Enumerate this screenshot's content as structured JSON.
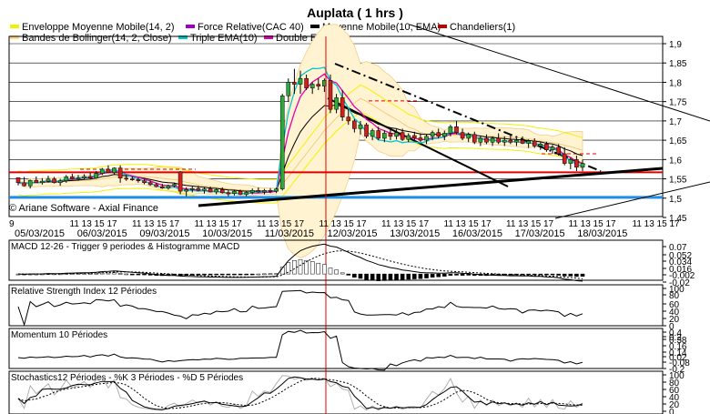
{
  "chart_title": "Auplata  ( 1 hrs )",
  "watermark": "© Ariane Software - Axial Finance",
  "legend": [
    {
      "label": "Enveloppe Moyenne Mobile(14, 2)",
      "color": "#f2f200"
    },
    {
      "label": "Force Relative(CAC 40)",
      "color": "#a000c0"
    },
    {
      "label": "Moyenne Mobile(10, EMA)",
      "color": "#000000"
    },
    {
      "label": "Chandeliers(1)",
      "color": "#c00000"
    },
    {
      "label": "Bandes de Bollinger(14, 2, Close)",
      "color": "#ffd68a"
    },
    {
      "label": "Triple EMA(10)",
      "color": "#00c8d2"
    },
    {
      "label": "Double EMA(10)",
      "color": "#e000b0"
    }
  ],
  "hour_ticks": [
    {
      "slot": 0,
      "label": "9"
    },
    {
      "slot": 1,
      "label": "11 13 15 17"
    },
    {
      "slot": 2,
      "label": "11 13 15 17"
    },
    {
      "slot": 3,
      "label": "11 13 15 17"
    },
    {
      "slot": 4,
      "label": "11 13 15 17"
    },
    {
      "slot": 5,
      "label": "11 13 15 17"
    },
    {
      "slot": 6,
      "label": "11 13 15 17"
    },
    {
      "slot": 7,
      "label": "11 13 15 17"
    },
    {
      "slot": 8,
      "label": "11 13 15 17"
    },
    {
      "slot": 9,
      "label": "11 13 15 17"
    }
  ],
  "date_labels": [
    {
      "slot": 0,
      "label": "05/03/2015"
    },
    {
      "slot": 1,
      "label": "06/03/2015"
    },
    {
      "slot": 2,
      "label": "09/03/2015"
    },
    {
      "slot": 3,
      "label": "10/03/2015"
    },
    {
      "slot": 4,
      "label": "11/03/2015"
    },
    {
      "slot": 5,
      "label": "12/03/2015"
    },
    {
      "slot": 6,
      "label": "13/03/2015"
    },
    {
      "slot": 7,
      "label": "16/03/2015"
    },
    {
      "slot": 8,
      "label": "17/03/2015"
    },
    {
      "slot": 9,
      "label": "18/03/2015"
    }
  ],
  "panels": {
    "price": {
      "ticks": [
        "1,9",
        "1,85",
        "1,8",
        "1,75",
        "1,7",
        "1,65",
        "1,6",
        "1,55",
        "1,5",
        "1,45"
      ]
    },
    "macd": {
      "label": "MACD 12-26  -  Trigger 9 periodes & Histogramme MACD",
      "ticks": [
        "0.07",
        "0.052",
        "0.034",
        "0.016",
        "-0.002",
        "-0.02"
      ]
    },
    "rsi": {
      "label": "Relative Strength Index 12 Périodes",
      "ticks": [
        "100",
        "80",
        "60",
        "40",
        "20",
        "0"
      ]
    },
    "momentum": {
      "label": "Momentum 10 Périodes",
      "ticks": [
        "0.4",
        "0.2",
        "0.38",
        "0.16",
        "0.14",
        "0.02",
        "-0.08",
        "-0.2"
      ]
    },
    "stochastics": {
      "label": "Stochastics12 Périodes  -  %K 3 Périodes  -  %D 5 Périodes",
      "ticks": [
        "100",
        "80",
        "60",
        "40",
        "20",
        "0"
      ]
    }
  },
  "chart_data": {
    "type": "candlestick",
    "title": "Auplata  ( 1 hrs )",
    "y_range": [
      1.45,
      1.92
    ],
    "candles": [
      [
        1.553,
        1.553,
        1.533,
        1.54
      ],
      [
        1.54,
        1.555,
        1.53,
        1.532
      ],
      [
        1.532,
        1.548,
        1.525,
        1.546
      ],
      [
        1.546,
        1.556,
        1.54,
        1.54
      ],
      [
        1.54,
        1.552,
        1.535,
        1.544
      ],
      [
        1.544,
        1.558,
        1.54,
        1.55
      ],
      [
        1.55,
        1.555,
        1.538,
        1.54
      ],
      [
        1.54,
        1.55,
        1.532,
        1.545
      ],
      [
        1.545,
        1.56,
        1.54,
        1.555
      ],
      [
        1.555,
        1.563,
        1.548,
        1.55
      ],
      [
        1.55,
        1.56,
        1.545,
        1.552
      ],
      [
        1.552,
        1.562,
        1.548,
        1.556
      ],
      [
        1.556,
        1.566,
        1.55,
        1.552
      ],
      [
        1.552,
        1.57,
        1.55,
        1.564
      ],
      [
        1.564,
        1.578,
        1.56,
        1.575
      ],
      [
        1.575,
        1.585,
        1.565,
        1.566
      ],
      [
        1.566,
        1.58,
        1.56,
        1.578
      ],
      [
        1.578,
        1.585,
        1.54,
        1.552
      ],
      [
        1.552,
        1.56,
        1.545,
        1.55
      ],
      [
        1.55,
        1.556,
        1.545,
        1.548
      ],
      [
        1.548,
        1.553,
        1.54,
        1.545
      ],
      [
        1.545,
        1.55,
        1.536,
        1.54
      ],
      [
        1.54,
        1.546,
        1.532,
        1.535
      ],
      [
        1.535,
        1.54,
        1.528,
        1.53
      ],
      [
        1.53,
        1.537,
        1.524,
        1.526
      ],
      [
        1.526,
        1.535,
        1.522,
        1.532
      ],
      [
        1.532,
        1.54,
        1.528,
        1.536
      ],
      [
        1.568,
        1.57,
        1.51,
        1.518
      ],
      [
        1.518,
        1.528,
        1.505,
        1.522
      ],
      [
        1.522,
        1.53,
        1.515,
        1.525
      ],
      [
        1.525,
        1.532,
        1.518,
        1.52
      ],
      [
        1.52,
        1.528,
        1.512,
        1.524
      ],
      [
        1.524,
        1.53,
        1.515,
        1.516
      ],
      [
        1.516,
        1.525,
        1.51,
        1.522
      ],
      [
        1.522,
        1.528,
        1.512,
        1.514
      ],
      [
        1.514,
        1.52,
        1.505,
        1.512
      ],
      [
        1.512,
        1.522,
        1.507,
        1.518
      ],
      [
        1.518,
        1.522,
        1.508,
        1.51
      ],
      [
        1.51,
        1.518,
        1.505,
        1.515
      ],
      [
        1.515,
        1.525,
        1.51,
        1.52
      ],
      [
        1.52,
        1.528,
        1.514,
        1.516
      ],
      [
        1.516,
        1.524,
        1.51,
        1.52
      ],
      [
        1.52,
        1.526,
        1.513,
        1.518
      ],
      [
        1.518,
        1.527,
        1.513,
        1.524
      ],
      [
        1.524,
        1.77,
        1.52,
        1.765
      ],
      [
        1.765,
        1.81,
        1.75,
        1.8
      ],
      [
        1.8,
        1.835,
        1.77,
        1.795
      ],
      [
        1.795,
        1.83,
        1.77,
        1.81
      ],
      [
        1.81,
        1.82,
        1.78,
        1.785
      ],
      [
        1.785,
        1.8,
        1.77,
        1.795
      ],
      [
        1.795,
        1.81,
        1.78,
        1.79
      ],
      [
        1.79,
        1.81,
        1.775,
        1.805
      ],
      [
        1.805,
        1.82,
        1.72,
        1.73
      ],
      [
        1.73,
        1.77,
        1.72,
        1.76
      ],
      [
        1.76,
        1.78,
        1.7,
        1.71
      ],
      [
        1.71,
        1.73,
        1.69,
        1.7
      ],
      [
        1.7,
        1.705,
        1.67,
        1.68
      ],
      [
        1.68,
        1.7,
        1.665,
        1.69
      ],
      [
        1.69,
        1.695,
        1.655,
        1.66
      ],
      [
        1.66,
        1.68,
        1.65,
        1.675
      ],
      [
        1.675,
        1.685,
        1.65,
        1.655
      ],
      [
        1.655,
        1.675,
        1.645,
        1.668
      ],
      [
        1.668,
        1.68,
        1.65,
        1.66
      ],
      [
        1.66,
        1.678,
        1.652,
        1.67
      ],
      [
        1.67,
        1.68,
        1.648,
        1.652
      ],
      [
        1.652,
        1.668,
        1.645,
        1.662
      ],
      [
        1.662,
        1.672,
        1.65,
        1.656
      ],
      [
        1.656,
        1.668,
        1.645,
        1.65
      ],
      [
        1.65,
        1.665,
        1.64,
        1.66
      ],
      [
        1.66,
        1.675,
        1.65,
        1.67
      ],
      [
        1.67,
        1.68,
        1.655,
        1.66
      ],
      [
        1.66,
        1.675,
        1.65,
        1.668
      ],
      [
        1.668,
        1.69,
        1.66,
        1.685
      ],
      [
        1.685,
        1.7,
        1.665,
        1.67
      ],
      [
        1.67,
        1.68,
        1.65,
        1.655
      ],
      [
        1.655,
        1.67,
        1.645,
        1.665
      ],
      [
        1.665,
        1.672,
        1.64,
        1.645
      ],
      [
        1.645,
        1.66,
        1.635,
        1.655
      ],
      [
        1.655,
        1.665,
        1.64,
        1.645
      ],
      [
        1.645,
        1.66,
        1.635,
        1.655
      ],
      [
        1.655,
        1.668,
        1.64,
        1.645
      ],
      [
        1.645,
        1.66,
        1.635,
        1.65
      ],
      [
        1.65,
        1.662,
        1.64,
        1.645
      ],
      [
        1.645,
        1.655,
        1.635,
        1.65
      ],
      [
        1.65,
        1.66,
        1.64,
        1.642
      ],
      [
        1.642,
        1.652,
        1.63,
        1.648
      ],
      [
        1.648,
        1.655,
        1.63,
        1.635
      ],
      [
        1.635,
        1.645,
        1.625,
        1.64
      ],
      [
        1.64,
        1.646,
        1.62,
        1.625
      ],
      [
        1.625,
        1.638,
        1.615,
        1.632
      ],
      [
        1.632,
        1.64,
        1.61,
        1.615
      ],
      [
        1.615,
        1.632,
        1.585,
        1.59
      ],
      [
        1.59,
        1.605,
        1.575,
        1.6
      ],
      [
        1.6,
        1.61,
        1.57,
        1.58
      ],
      [
        1.58,
        1.6,
        1.57,
        1.59
      ]
    ]
  }
}
